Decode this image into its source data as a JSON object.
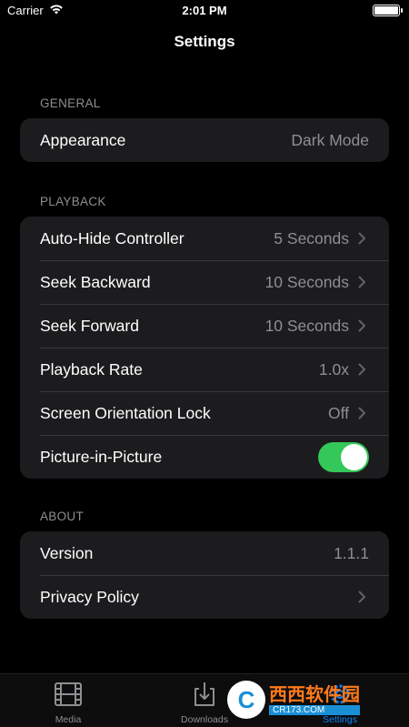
{
  "status_bar": {
    "carrier": "Carrier",
    "time": "2:01 PM"
  },
  "nav": {
    "title": "Settings"
  },
  "sections": {
    "general": {
      "header": "GENERAL",
      "appearance": {
        "label": "Appearance",
        "value": "Dark Mode"
      }
    },
    "playback": {
      "header": "PLAYBACK",
      "auto_hide": {
        "label": "Auto-Hide Controller",
        "value": "5 Seconds"
      },
      "seek_backward": {
        "label": "Seek Backward",
        "value": "10 Seconds"
      },
      "seek_forward": {
        "label": "Seek Forward",
        "value": "10 Seconds"
      },
      "playback_rate": {
        "label": "Playback Rate",
        "value": "1.0x"
      },
      "orientation_lock": {
        "label": "Screen Orientation Lock",
        "value": "Off"
      },
      "pip": {
        "label": "Picture-in-Picture",
        "enabled": true
      }
    },
    "about": {
      "header": "ABOUT",
      "version": {
        "label": "Version",
        "value": "1.1.1"
      },
      "privacy": {
        "label": "Privacy Policy"
      }
    }
  },
  "tab_bar": {
    "media": {
      "label": "Media",
      "icon": "film-icon"
    },
    "downloads": {
      "label": "Downloads",
      "icon": "download-icon"
    },
    "settings": {
      "label": "Settings",
      "icon": "gear-icon",
      "active": true
    }
  },
  "watermark": {
    "main": "西西软件园",
    "url": "CR173.COM"
  },
  "colors": {
    "accent": "#0a84ff",
    "toggle_on": "#34c759",
    "cell_bg": "#1c1c1e",
    "secondary_text": "#8e8e93"
  }
}
